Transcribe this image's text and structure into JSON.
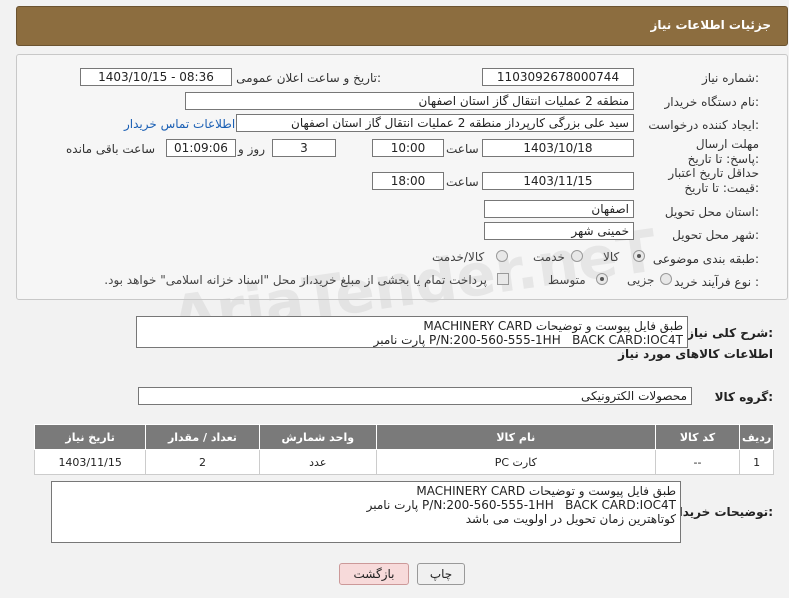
{
  "header": {
    "title": "جزئیات اطلاعات نیاز"
  },
  "form": {
    "need_number": {
      "label": "شماره نیاز:",
      "value": "1103092678000744"
    },
    "announce": {
      "label": "تاریخ و ساعت اعلان عمومی:",
      "value": "1403/10/15 - 08:36"
    },
    "buyer_org": {
      "label": "نام دستگاه خریدار:",
      "value": "منطقه 2 عملیات انتقال گاز استان اصفهان"
    },
    "requester": {
      "label": "ایجاد کننده درخواست:",
      "value": "سید علی بزرگی کارپرداز منطقه 2 عملیات انتقال گاز استان اصفهان",
      "contact_link": "اطلاعات تماس خریدار"
    },
    "deadline": {
      "label": "مهلت ارسال پاسخ: تا تاریخ:",
      "date": "1403/10/18",
      "time_label": "ساعت",
      "time": "10:00",
      "days": "3",
      "days_label": "روز و",
      "remaining": "01:09:06",
      "remaining_label": "ساعت باقی مانده"
    },
    "validity": {
      "label": "حداقل تاریخ اعتبار قیمت: تا تاریخ:",
      "date": "1403/11/15",
      "time_label": "ساعت",
      "time": "18:00"
    },
    "province": {
      "label": "استان محل تحویل:",
      "value": "اصفهان"
    },
    "city": {
      "label": "شهر محل تحویل:",
      "value": "خمینی شهر"
    },
    "category": {
      "label": "طبقه بندی موضوعی:",
      "options": [
        "کالا",
        "خدمت",
        "کالا/خدمت"
      ]
    },
    "process": {
      "label": "نوع فرآیند خرید :",
      "options": [
        "جزیی",
        "متوسط"
      ],
      "note": "پرداخت تمام یا بخشی از مبلغ خرید،از محل \"اسناد خزانه اسلامی\" خواهد بود."
    }
  },
  "summary": {
    "label": "شرح کلی نیاز:",
    "text": "MACHINERY CARD طبق فایل پیوست و توضیحات\nپارت نامبر P/N:200-560-555-1HH   BACK CARD:IOC4T"
  },
  "goods_info": {
    "title": "اطلاعات کالاهای مورد نیاز",
    "group_label": "گروه کالا:",
    "group_value": "محصولات الکترونیکی"
  },
  "table": {
    "headers": [
      "ردیف",
      "کد کالا",
      "نام کالا",
      "واحد شمارش",
      "تعداد / مقدار",
      "تاریخ نیاز"
    ],
    "rows": [
      [
        "1",
        "--",
        "کارت PC",
        "عدد",
        "2",
        "1403/11/15"
      ]
    ]
  },
  "buyer_notes": {
    "label": "توضیحات خریدار:",
    "text": "MACHINERY CARD طبق فایل پیوست و توضیحات\nپارت نامبر P/N:200-560-555-1HH   BACK CARD:IOC4T\nکوتاهترین زمان تحویل در اولویت می باشد"
  },
  "buttons": {
    "print": "چاپ",
    "back": "بازگشت"
  },
  "watermark": "AriaTender.neT"
}
